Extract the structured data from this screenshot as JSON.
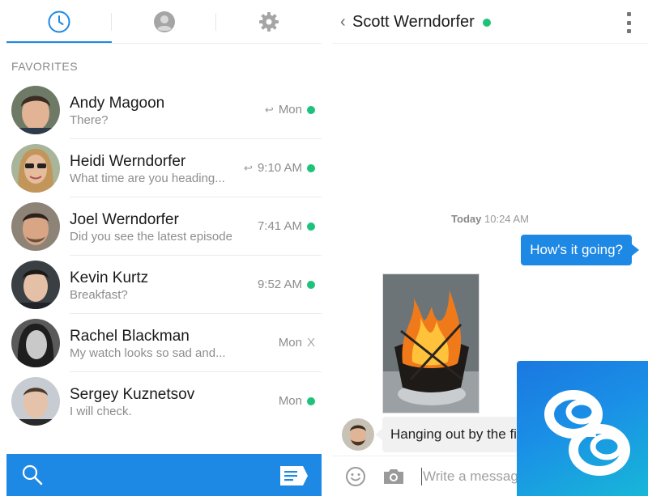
{
  "tabs": [
    {
      "id": "recent",
      "icon": "clock-icon",
      "selected": true
    },
    {
      "id": "contacts",
      "icon": "person-icon",
      "selected": false
    },
    {
      "id": "settings",
      "icon": "gear-icon",
      "selected": false
    }
  ],
  "favorites_label": "FAVORITES",
  "contacts": [
    {
      "name": "Andy Magoon",
      "preview": "There?",
      "time": "Mon",
      "replied": true,
      "status": "online"
    },
    {
      "name": "Heidi Werndorfer",
      "preview": "What time are you heading...",
      "time": "9:10 AM",
      "replied": true,
      "status": "online"
    },
    {
      "name": "Joel Werndorfer",
      "preview": "Did you see the latest episode?",
      "time": "7:41 AM",
      "replied": false,
      "status": "online"
    },
    {
      "name": "Kevin Kurtz",
      "preview": "Breakfast?",
      "time": "9:52 AM",
      "replied": false,
      "status": "online"
    },
    {
      "name": "Rachel Blackman",
      "preview": "My watch looks so sad and...",
      "time": "Mon",
      "replied": false,
      "status": "offline",
      "status_mark": "X"
    },
    {
      "name": "Sergey Kuznetsov",
      "preview": "I will check.",
      "time": "Mon",
      "replied": false,
      "status": "online"
    }
  ],
  "chat": {
    "back_glyph": "‹",
    "contact_name": "Scott Werndorfer",
    "timestamp_day": "Today",
    "timestamp_time": "10:24 AM",
    "outgoing_message": "How's it going?",
    "incoming_message": "Hanging out by the fi",
    "composer_placeholder": "Write a messag"
  },
  "colors": {
    "accent": "#1e88e5",
    "online": "#1ec27a",
    "incoming_bubble": "#f1f1f1",
    "logo_gradient_start": "#1b78e0",
    "logo_gradient_end": "#18b7d8"
  },
  "icons": {
    "bottom_left": "search-icon",
    "bottom_right": "compose-icon",
    "header_menu": "more-vert-icon",
    "composer_left": "emoji-icon",
    "composer_camera": "camera-icon",
    "overlay": "app-logo"
  }
}
